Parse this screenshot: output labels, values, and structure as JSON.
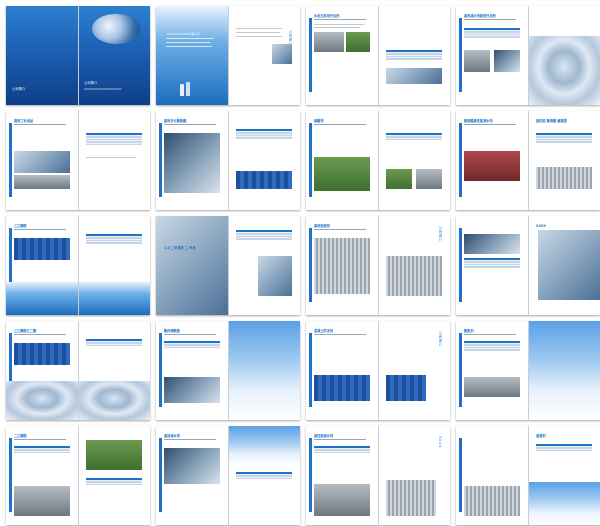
{
  "cover": {
    "title": "公司简介",
    "subtitle": "XXXXXXXXXXXXXXXXXXXXXXXXX"
  },
  "intro": {
    "title": "XXXXXXXXXXXXX有限公司",
    "brand": "公司简介"
  },
  "spread_headings": {
    "r0c2": "水泥生料用外加剂",
    "r0c3": "XXXX",
    "r0c4": "高效减水剂新型外加剂",
    "r1c0": "高效工业用品",
    "r1c1": "高效多元聚羧酸",
    "r1c2": "碳酸钙",
    "r1c3": "聚羧酸高性能减水剂",
    "r1c4": "高性能 聚羧酸 缓凝型",
    "r2c0": "三乙醇胺",
    "r2c1": "1,4-二甲基苯 二 甲苯",
    "r2c2": "高效阻锈剂",
    "r2c3": "公司简介",
    "r2c4": "XXXX",
    "r3c0": "三乙醇胺乙二醇",
    "r3c1": "聚丙烯酰胺",
    "r3c2": "混凝土防冻剂",
    "r3c3": "公司简介",
    "r3c4": "膨胀剂",
    "r4c0": "二乙醇胺",
    "r4c1": "高效减水剂",
    "r4c2": "高性能减水剂",
    "r4c3": "XXXX",
    "r4c4": "速凝剂"
  }
}
